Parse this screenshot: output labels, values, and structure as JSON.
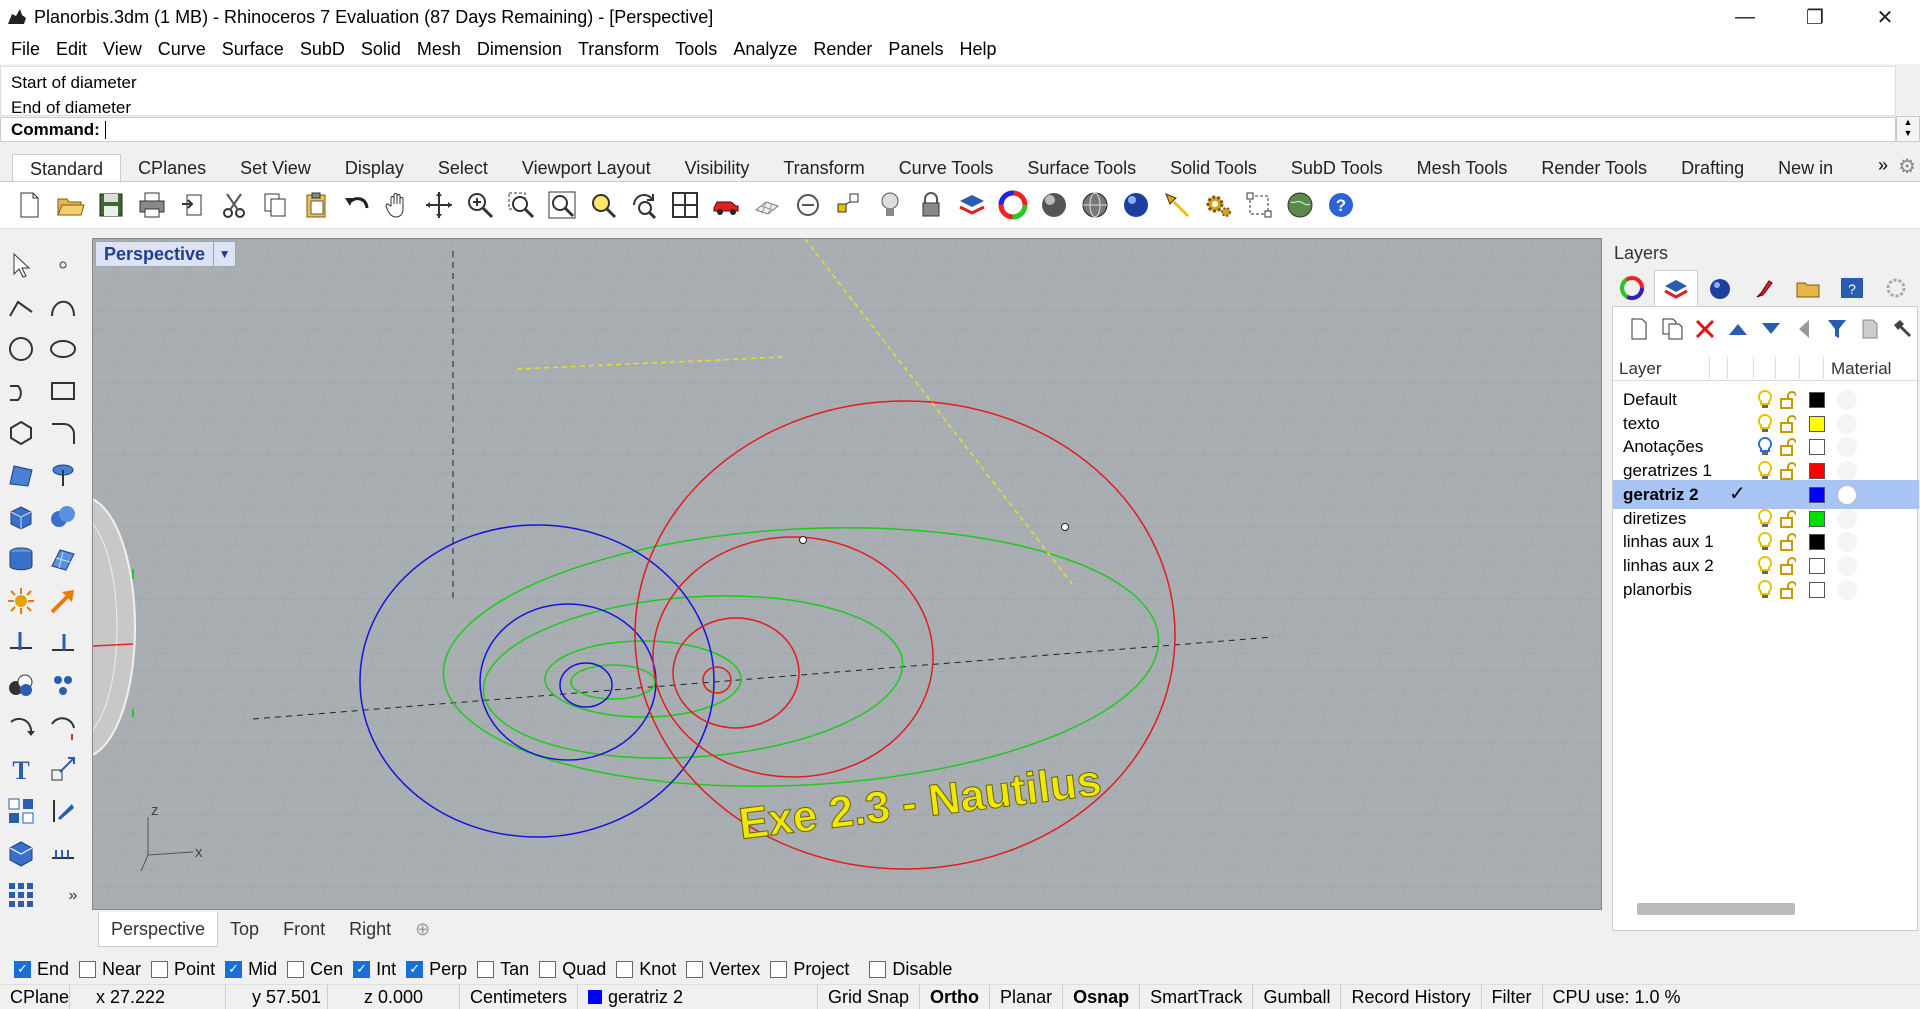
{
  "window": {
    "title": "Planorbis.3dm (1 MB) - Rhinoceros 7 Evaluation (87 Days Remaining) - [Perspective]",
    "minimize": "—",
    "restore": "❐",
    "close": "✕"
  },
  "menu": [
    "File",
    "Edit",
    "View",
    "Curve",
    "Surface",
    "SubD",
    "Solid",
    "Mesh",
    "Dimension",
    "Transform",
    "Tools",
    "Analyze",
    "Render",
    "Panels",
    "Help"
  ],
  "command": {
    "history": [
      "Start of diameter",
      "End of diameter"
    ],
    "prompt": "Command:",
    "value": ""
  },
  "tabs": {
    "items": [
      "Standard",
      "CPlanes",
      "Set View",
      "Display",
      "Select",
      "Viewport Layout",
      "Visibility",
      "Transform",
      "Curve Tools",
      "Surface Tools",
      "Solid Tools",
      "SubD Tools",
      "Mesh Tools",
      "Render Tools",
      "Drafting",
      "New in"
    ],
    "active": "Standard",
    "more": "»"
  },
  "toolbar_icons": [
    "new-icon",
    "open-icon",
    "save-icon",
    "print-icon",
    "import-icon",
    "cut-icon",
    "copy-icon",
    "paste-icon",
    "undo-icon",
    "pan-icon",
    "rotate-view-icon",
    "zoom-icon",
    "zoom-window-icon",
    "zoom-extents-icon",
    "zoom-selected-icon",
    "rotate-camera-icon",
    "four-views-icon",
    "car-icon",
    "grid-icon",
    "point-on-icon",
    "snap-icon",
    "light-icon",
    "lock-icon",
    "layer-icon",
    "color-wheel-icon",
    "sphere-shaded-icon",
    "sphere-wire-icon",
    "sphere-render-icon",
    "light-spot-icon",
    "gear-icon",
    "dimension-icon",
    "globe-icon",
    "help-icon"
  ],
  "viewport": {
    "name": "Perspective",
    "annotation": "Exe 2.3 - Nautilus",
    "axis_x": "x",
    "axis_z": "z"
  },
  "viewport_tabs": [
    "Perspective",
    "Top",
    "Front",
    "Right"
  ],
  "viewport_tab_add": "⊕",
  "layers": {
    "panel_title": "Layers",
    "col_layer": "Layer",
    "col_material": "Material",
    "rows": [
      {
        "name": "Default",
        "color": "#000000",
        "current": false,
        "bulb_color": "#e8c200"
      },
      {
        "name": "texto",
        "color": "#ffff00",
        "current": false,
        "bulb_color": "#e8c200"
      },
      {
        "name": "Anotações",
        "color": "#ffffff",
        "current": false,
        "bulb_color": "#2a6fd6"
      },
      {
        "name": "geratrizes 1",
        "color": "#ff0000",
        "current": false,
        "bulb_color": "#e8c200"
      },
      {
        "name": "geratriz 2",
        "color": "#0000ff",
        "current": true,
        "bulb_color": ""
      },
      {
        "name": "diretizes",
        "color": "#00dd00",
        "current": false,
        "bulb_color": "#e8c200"
      },
      {
        "name": "linhas aux 1",
        "color": "#000000",
        "current": false,
        "bulb_color": "#e8c200"
      },
      {
        "name": "linhas aux 2",
        "color": "#ffffff",
        "current": false,
        "bulb_color": "#e8c200"
      },
      {
        "name": "planorbis",
        "color": "#ffffff",
        "current": false,
        "bulb_color": "#e8c200"
      }
    ],
    "current_mark": "✓"
  },
  "osnaps": [
    {
      "label": "End",
      "checked": true
    },
    {
      "label": "Near",
      "checked": false
    },
    {
      "label": "Point",
      "checked": false
    },
    {
      "label": "Mid",
      "checked": true
    },
    {
      "label": "Cen",
      "checked": false
    },
    {
      "label": "Int",
      "checked": true
    },
    {
      "label": "Perp",
      "checked": true
    },
    {
      "label": "Tan",
      "checked": false
    },
    {
      "label": "Quad",
      "checked": false
    },
    {
      "label": "Knot",
      "checked": false
    },
    {
      "label": "Vertex",
      "checked": false
    },
    {
      "label": "Project",
      "checked": false
    },
    {
      "label": "Disable",
      "checked": false
    }
  ],
  "status": {
    "cplane": "CPlane",
    "x": "x 27.222",
    "y": "y 57.501",
    "z": "z 0.000",
    "units": "Centimeters",
    "layer": "geratriz 2",
    "grid_snap": "Grid Snap",
    "ortho": "Ortho",
    "planar": "Planar",
    "osnap": "Osnap",
    "smarttrack": "SmartTrack",
    "gumball": "Gumball",
    "record_history": "Record History",
    "filter": "Filter",
    "cpu": "CPU use: 1.0 %"
  }
}
